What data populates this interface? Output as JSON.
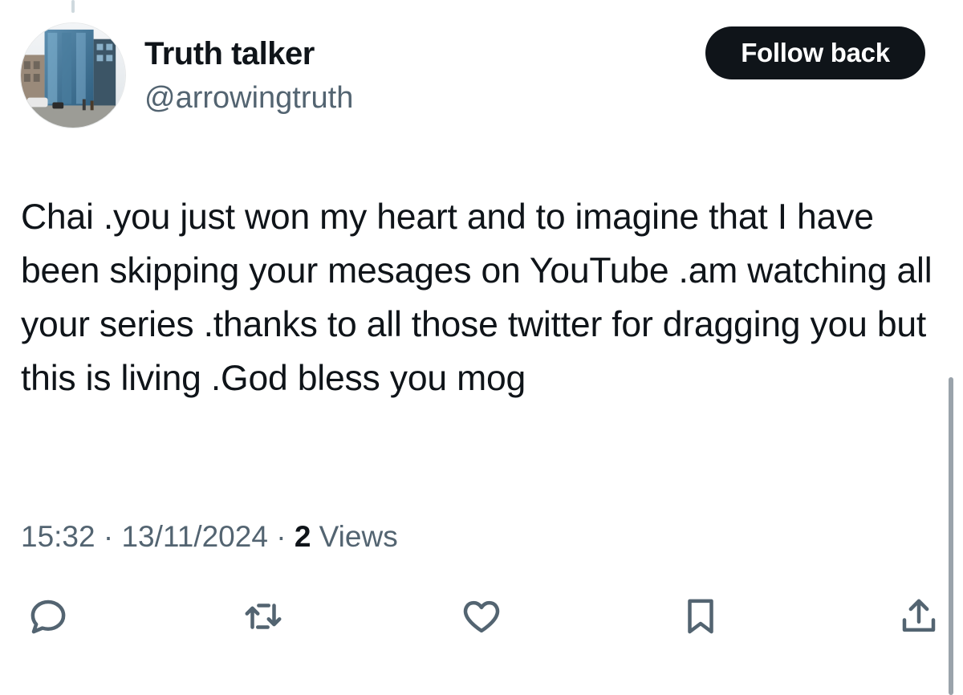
{
  "tweet": {
    "author": {
      "display_name": "Truth talker",
      "handle": "@arrowingtruth"
    },
    "follow_button_label": "Follow back",
    "text": "Chai .you just won my heart and to imagine that I have been skipping your mesages on YouTube .am watching all your series .thanks to all those twitter for dragging you but this is living .God bless you mog",
    "meta": {
      "time": "15:32",
      "separator": " · ",
      "date": "13/11/2024",
      "views_count": "2",
      "views_label": " Views"
    }
  },
  "actions": {
    "icons": [
      "reply-icon",
      "retweet-icon",
      "like-icon",
      "bookmark-icon",
      "share-icon"
    ]
  },
  "colors": {
    "text_primary": "#0f1419",
    "text_secondary": "#536471",
    "button_bg": "#0f1419",
    "button_text": "#ffffff"
  }
}
